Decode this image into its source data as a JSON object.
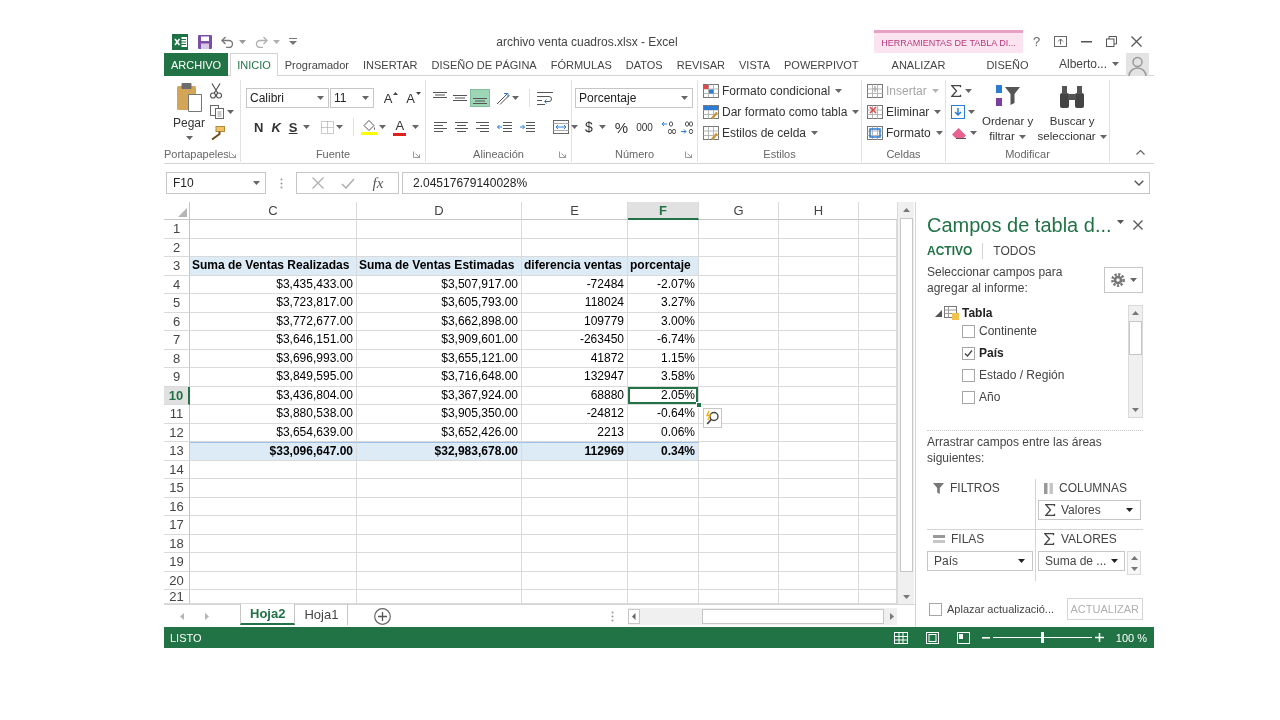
{
  "window": {
    "title": "archivo venta cuadros.xlsx - Excel",
    "context_group": "HERRAMIENTAS DE TABLA DI...",
    "help": "?"
  },
  "ribbon_tabs": [
    {
      "label": "ARCHIVO",
      "kind": "file",
      "selected": false
    },
    {
      "label": "INICIO",
      "kind": "standard",
      "selected": true
    },
    {
      "label": "Programador",
      "kind": "standard",
      "selected": false
    },
    {
      "label": "INSERTAR",
      "kind": "standard",
      "selected": false
    },
    {
      "label": "DISEÑO DE PÁGINA",
      "kind": "standard",
      "selected": false
    },
    {
      "label": "FÓRMULAS",
      "kind": "standard",
      "selected": false
    },
    {
      "label": "DATOS",
      "kind": "standard",
      "selected": false
    },
    {
      "label": "REVISAR",
      "kind": "standard",
      "selected": false
    },
    {
      "label": "VISTA",
      "kind": "standard",
      "selected": false
    },
    {
      "label": "POWERPIVOT",
      "kind": "standard",
      "selected": false
    },
    {
      "label": "ANALIZAR",
      "kind": "contextual",
      "selected": false
    },
    {
      "label": "DISEÑO",
      "kind": "contextual",
      "selected": false
    }
  ],
  "account": {
    "user": "Alberto..."
  },
  "ribbon_groups": [
    {
      "kind": "clipboard",
      "label": "Portapapeles",
      "launcher": true,
      "paste": "Pegar"
    },
    {
      "kind": "font",
      "label": "Fuente",
      "launcher": true,
      "font_name": "Calibri",
      "font_size": "11",
      "grow_font": "A",
      "shrink_font": "A",
      "bold": "N",
      "italic": "K",
      "underline": "S",
      "font_color": "A"
    },
    {
      "kind": "alignment",
      "label": "Alineación",
      "launcher": true,
      "vertical": [
        {
          "kind": "top",
          "selected": false
        },
        {
          "kind": "middle",
          "selected": false
        },
        {
          "kind": "bottom",
          "selected": true
        }
      ]
    },
    {
      "kind": "number",
      "label": "Número",
      "launcher": true,
      "format": "Porcentaje",
      "currency": "$",
      "percent": "%",
      "thousands": "000"
    },
    {
      "kind": "styles",
      "label": "Estilos",
      "launcher": false,
      "commands": [
        {
          "kind": "conditional",
          "label": "Formato condicional"
        },
        {
          "kind": "table",
          "label": "Dar formato como tabla"
        },
        {
          "kind": "cell_styles",
          "label": "Estilos de celda"
        }
      ]
    },
    {
      "kind": "cells",
      "label": "Celdas",
      "launcher": false,
      "commands": [
        {
          "kind": "insert",
          "label": "Insertar",
          "disabled": true
        },
        {
          "kind": "delete",
          "label": "Eliminar",
          "disabled": false
        },
        {
          "kind": "format",
          "label": "Formato",
          "disabled": false
        }
      ]
    },
    {
      "kind": "editing",
      "label": "Modificar",
      "launcher": false,
      "sort": "Ordenar y filtrar",
      "find": "Buscar y seleccionar"
    }
  ],
  "formula_bar": {
    "name_box": "F10",
    "function_button": "fx",
    "formula": "2.04517679140028%"
  },
  "sheet": {
    "columns": [
      {
        "label": "C",
        "selected": false
      },
      {
        "label": "D",
        "selected": false
      },
      {
        "label": "E",
        "selected": false
      },
      {
        "label": "F",
        "selected": true
      },
      {
        "label": "G",
        "selected": false
      },
      {
        "label": "H",
        "selected": false
      }
    ],
    "rows": [
      {
        "number": "1",
        "kind": "blank",
        "selected": false
      },
      {
        "number": "2",
        "kind": "blank",
        "selected": false
      },
      {
        "number": "3",
        "kind": "header",
        "selected": false,
        "cells": [
          "Suma de Ventas Realizadas",
          "Suma de Ventas Estimadas",
          "diferencia ventas",
          "porcentaje"
        ]
      },
      {
        "number": "4",
        "kind": "data",
        "selected": false,
        "cells": [
          "$3,435,433.00",
          "$3,507,917.00",
          "-72484",
          "-2.07%"
        ]
      },
      {
        "number": "5",
        "kind": "data",
        "selected": false,
        "cells": [
          "$3,723,817.00",
          "$3,605,793.00",
          "118024",
          "3.27%"
        ]
      },
      {
        "number": "6",
        "kind": "data",
        "selected": false,
        "cells": [
          "$3,772,677.00",
          "$3,662,898.00",
          "109779",
          "3.00%"
        ]
      },
      {
        "number": "7",
        "kind": "data",
        "selected": false,
        "cells": [
          "$3,646,151.00",
          "$3,909,601.00",
          "-263450",
          "-6.74%"
        ]
      },
      {
        "number": "8",
        "kind": "data",
        "selected": false,
        "cells": [
          "$3,696,993.00",
          "$3,655,121.00",
          "41872",
          "1.15%"
        ]
      },
      {
        "number": "9",
        "kind": "data",
        "selected": false,
        "cells": [
          "$3,849,595.00",
          "$3,716,648.00",
          "132947",
          "3.58%"
        ]
      },
      {
        "number": "10",
        "kind": "data",
        "selected": true,
        "cells": [
          "$3,436,804.00",
          "$3,367,924.00",
          "68880",
          "2.05%"
        ]
      },
      {
        "number": "11",
        "kind": "data",
        "selected": false,
        "cells": [
          "$3,880,538.00",
          "$3,905,350.00",
          "-24812",
          "-0.64%"
        ]
      },
      {
        "number": "12",
        "kind": "data",
        "selected": false,
        "cells": [
          "$3,654,639.00",
          "$3,652,426.00",
          "2213",
          "0.06%"
        ]
      },
      {
        "number": "13",
        "kind": "total",
        "selected": false,
        "cells": [
          "$33,096,647.00",
          "$32,983,678.00",
          "112969",
          "0.34%"
        ]
      },
      {
        "number": "14",
        "kind": "blank",
        "selected": false
      },
      {
        "number": "15",
        "kind": "blank",
        "selected": false
      },
      {
        "number": "16",
        "kind": "blank",
        "selected": false
      },
      {
        "number": "17",
        "kind": "blank",
        "selected": false
      },
      {
        "number": "18",
        "kind": "blank",
        "selected": false
      },
      {
        "number": "19",
        "kind": "blank",
        "selected": false
      },
      {
        "number": "20",
        "kind": "blank",
        "selected": false
      },
      {
        "number": "21",
        "kind": "blank",
        "selected": false
      }
    ]
  },
  "sheet_tabs": [
    {
      "label": "Hoja2",
      "selected": true
    },
    {
      "label": "Hoja1",
      "selected": false
    }
  ],
  "field_pane": {
    "title": "Campos de tabla d...",
    "tabs": [
      {
        "label": "ACTIVO",
        "selected": true
      },
      {
        "label": "TODOS",
        "selected": false
      }
    ],
    "instruction": "Seleccionar campos para agregar al informe:",
    "table": {
      "label": "Tabla",
      "expanded": true,
      "children": [
        {
          "label": "Continente",
          "checked": false
        },
        {
          "label": "País",
          "checked": true
        },
        {
          "label": "Estado / Región",
          "checked": false
        },
        {
          "label": "Año",
          "checked": false
        }
      ]
    },
    "areas_instruction": "Arrastrar campos entre las áreas siguientes:",
    "areas": [
      {
        "kind": "filters",
        "label": "FILTROS",
        "scrollable": false
      },
      {
        "kind": "columns",
        "label": "COLUMNAS",
        "scrollable": false,
        "items": [
          {
            "kind": "values",
            "label": "Valores"
          }
        ]
      },
      {
        "kind": "rows",
        "label": "FILAS",
        "scrollable": false,
        "items": [
          {
            "kind": "field",
            "label": "País"
          }
        ]
      },
      {
        "kind": "values",
        "label": "VALORES",
        "scrollable": true,
        "items": [
          {
            "kind": "field",
            "label": "Suma de ..."
          }
        ]
      }
    ],
    "defer": {
      "label": "Aplazar actualizació...",
      "checked": false
    },
    "update_button": {
      "label": "ACTUALIZAR",
      "disabled": true
    }
  },
  "status_bar": {
    "status": "LISTO",
    "zoom_slider": {
      "level": 0.5
    },
    "zoom": "100 %"
  }
}
